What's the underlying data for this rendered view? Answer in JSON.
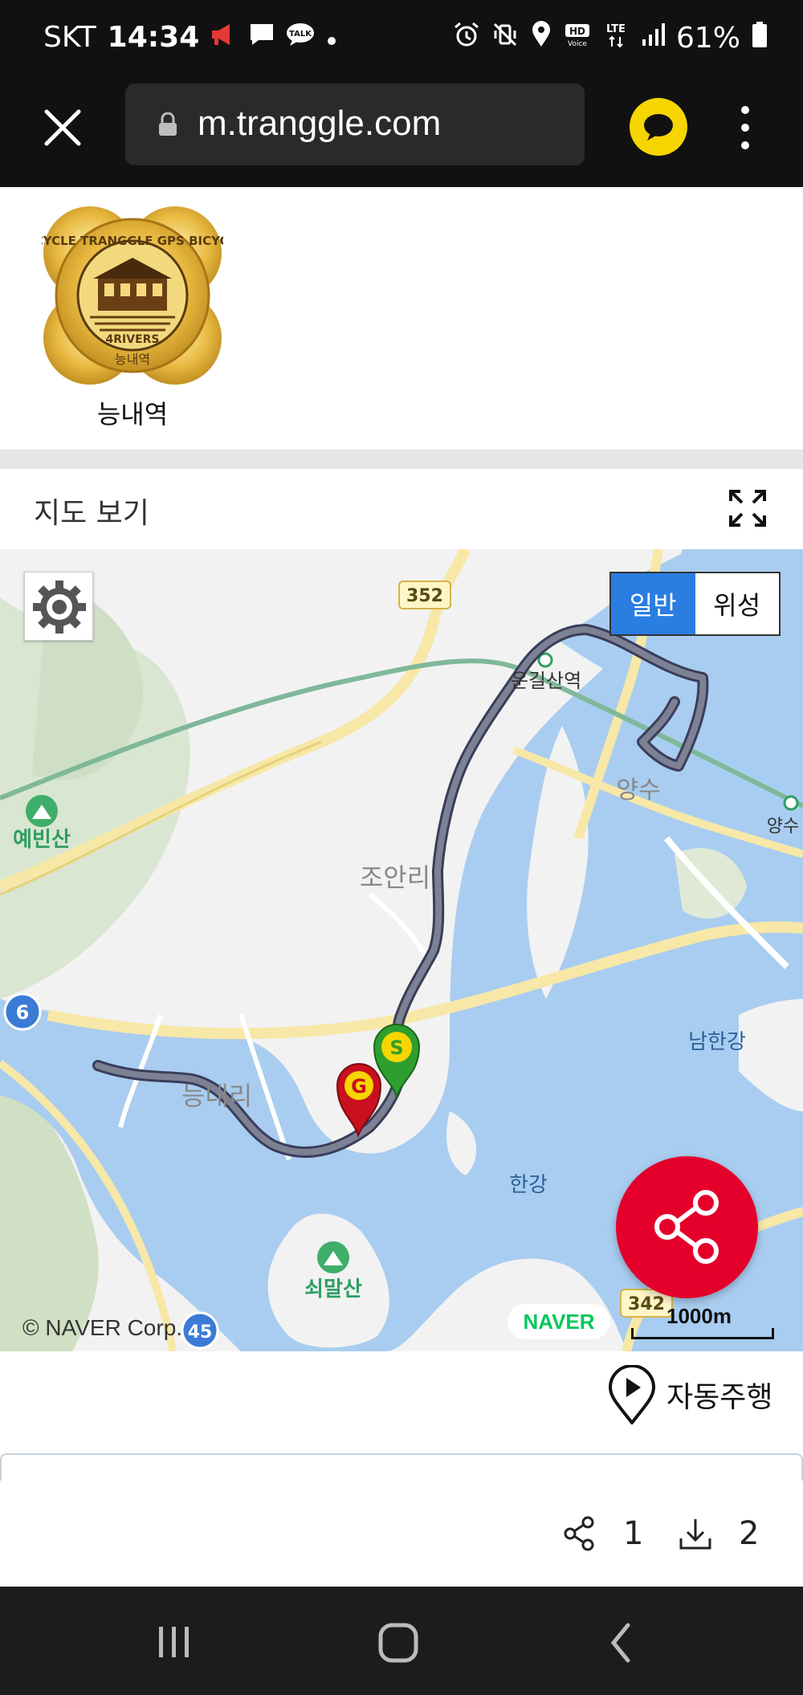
{
  "status_bar": {
    "carrier": "SKT",
    "time": "14:34",
    "battery": "61%",
    "network": "LTE"
  },
  "browser": {
    "url": "m.tranggle.com"
  },
  "badge": {
    "label": "능내역",
    "medal_text": "BICYCLE TRANGGLE GPS BICYCLE",
    "medal_sub": "4RIVERS",
    "medal_station": "능내역"
  },
  "map_section": {
    "title": "지도 보기",
    "map_type": {
      "normal": "일반",
      "satellite": "위성",
      "selected": "normal"
    },
    "labels": {
      "road_352": "352",
      "road_6": "6",
      "road_45": "45",
      "road_342": "342",
      "ungil_station": "운길산역",
      "yebinsan": "예빈산",
      "joanri": "조안리",
      "yangsu": "양수",
      "yangsu2": "양수",
      "namhangang": "남한강",
      "hangang": "한강",
      "neungnaeri": "능내리",
      "soemalsan": "쇠말산"
    },
    "start_marker": "S",
    "goal_marker": "G",
    "copyright": "© NAVER Corp.",
    "naver_logo": "NAVER",
    "scale": "1000m"
  },
  "actions": {
    "autodrive_label": "자동주행",
    "share_count": "1",
    "download_count": "2"
  },
  "colors": {
    "route": "#5a6680",
    "water": "#a9cdf0",
    "land": "#f2f2f2",
    "share_fab": "#e4002b",
    "map_type_active": "#2a7de1"
  }
}
